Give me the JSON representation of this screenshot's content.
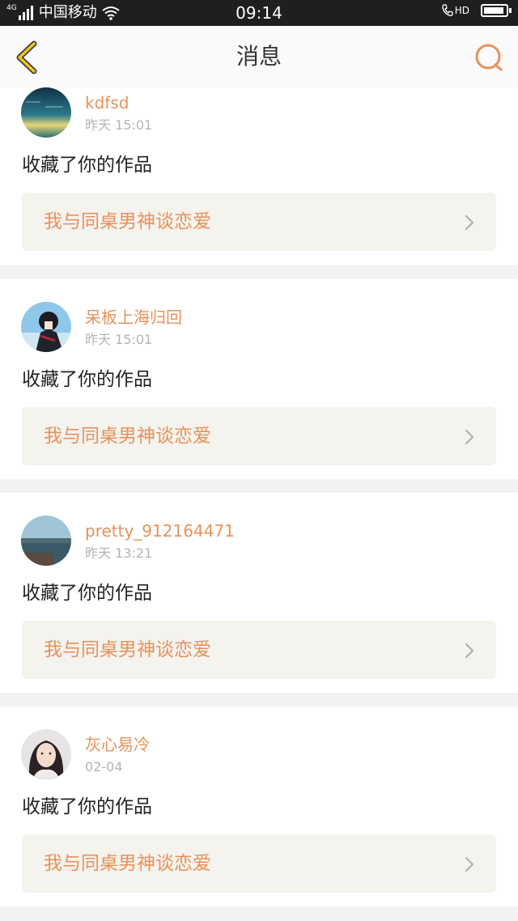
{
  "status_bar": {
    "network": "4G",
    "carrier": "中国移动",
    "time": "09:14",
    "hd_label": "HD"
  },
  "nav": {
    "title": "消息",
    "back_icon": "chevron-left-icon",
    "search_icon": "search-icon"
  },
  "colors": {
    "accent": "#e8915b",
    "back_icon": "#f0c419",
    "work_card_bg": "#f4f3ee"
  },
  "messages": [
    {
      "username": "kdfsd",
      "time": "昨天 15:01",
      "action": "收藏了你的作品",
      "work_title": "我与同桌男神谈恋爱"
    },
    {
      "username": "呆板上海归回",
      "time": "昨天 15:01",
      "action": "收藏了你的作品",
      "work_title": "我与同桌男神谈恋爱"
    },
    {
      "username": "pretty_912164471",
      "time": "昨天 13:21",
      "action": "收藏了你的作品",
      "work_title": "我与同桌男神谈恋爱"
    },
    {
      "username": "灰心易冷",
      "time": "02-04",
      "action": "收藏了你的作品",
      "work_title": "我与同桌男神谈恋爱"
    }
  ]
}
